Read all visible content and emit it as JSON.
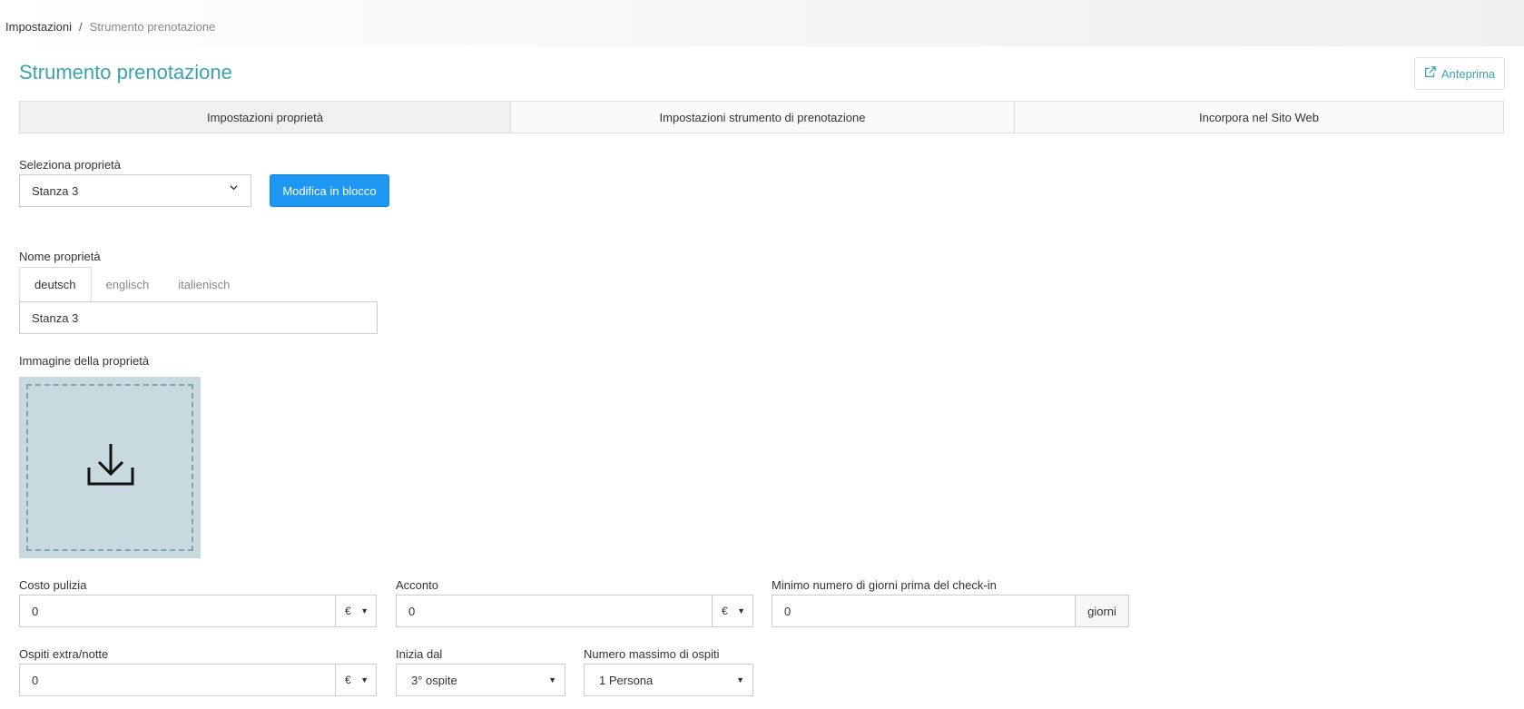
{
  "breadcrumb": {
    "root": "Impostazioni",
    "separator": "/",
    "current": "Strumento prenotazione"
  },
  "page": {
    "title": "Strumento prenotazione",
    "preview_label": "Anteprima"
  },
  "tabs": [
    {
      "label": "Impostazioni proprietà",
      "active": true
    },
    {
      "label": "Impostazioni strumento di prenotazione",
      "active": false
    },
    {
      "label": "Incorpora nel Sito Web",
      "active": false
    }
  ],
  "property_select": {
    "label": "Seleziona proprietà",
    "value": "Stanza 3",
    "bulk_edit_label": "Modifica in blocco"
  },
  "property_name": {
    "label": "Nome proprietà",
    "languages": [
      {
        "label": "deutsch",
        "active": true
      },
      {
        "label": "englisch",
        "active": false
      },
      {
        "label": "italienisch",
        "active": false
      }
    ],
    "value": "Stanza 3"
  },
  "image": {
    "label": "Immagine della proprietà",
    "icon": "download-icon"
  },
  "cleaning_cost": {
    "label": "Costo pulizia",
    "value": "0",
    "currency": "€"
  },
  "deposit": {
    "label": "Acconto",
    "value": "0",
    "currency": "€"
  },
  "min_days": {
    "label": "Minimo numero di giorni prima del check-in",
    "value": "0",
    "unit": "giorni"
  },
  "extra_guests": {
    "label": "Ospiti extra/notte",
    "value": "0",
    "currency": "€"
  },
  "starts_from": {
    "label": "Inizia dal",
    "value": "3° ospite"
  },
  "max_guests": {
    "label": "Numero massimo di ospiti",
    "value": "1 Persona"
  },
  "colors": {
    "accent": "#3aa3ad",
    "primary_button": "#1e97f3",
    "upload_bg": "#c8d9df"
  }
}
